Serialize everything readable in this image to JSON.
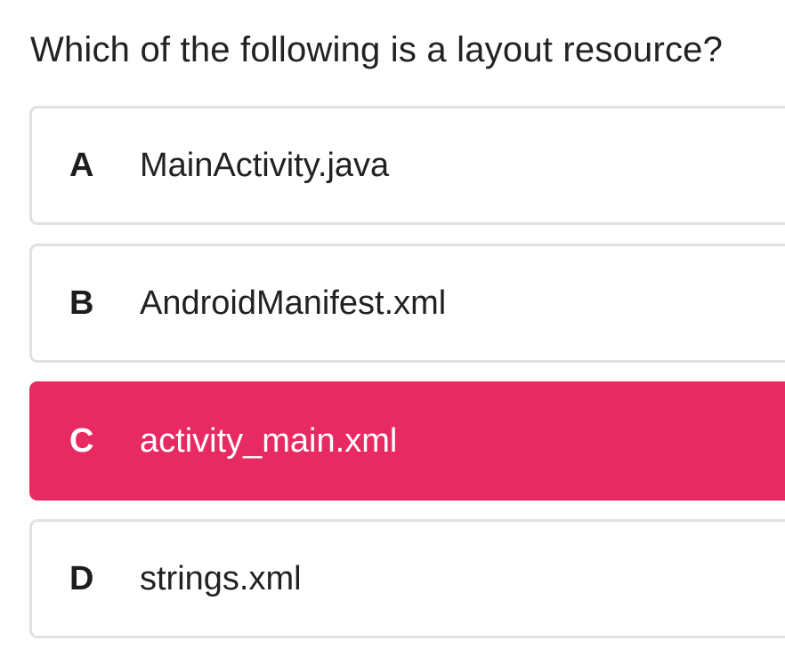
{
  "question": "Which of the following is a layout resource?",
  "options": [
    {
      "letter": "A",
      "text": "MainActivity.java"
    },
    {
      "letter": "B",
      "text": "AndroidManifest.xml"
    },
    {
      "letter": "C",
      "text": "activity_main.xml",
      "selected": true
    },
    {
      "letter": "D",
      "text": "strings.xml"
    }
  ],
  "colors": {
    "selected_background": "#e82a63",
    "option_border": "#e1e1e1",
    "text": "#222222",
    "selected_text": "#ffffff"
  }
}
